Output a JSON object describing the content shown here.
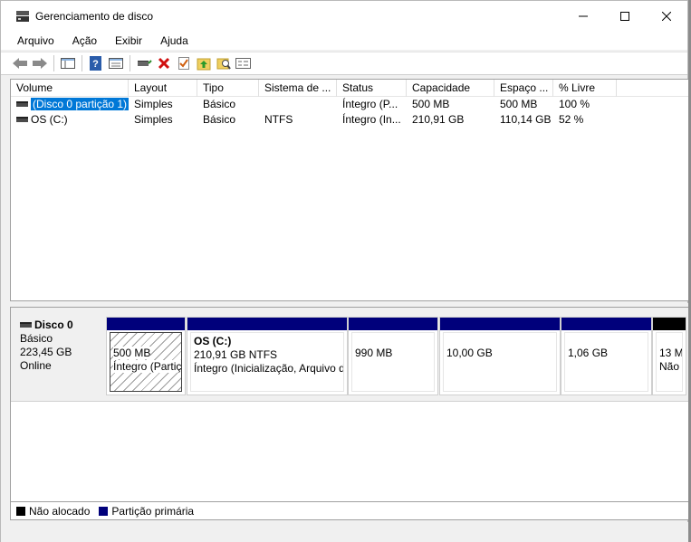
{
  "window": {
    "title": "Gerenciamento de disco"
  },
  "menu": [
    "Arquivo",
    "Ação",
    "Exibir",
    "Ajuda"
  ],
  "toolbar_icons": [
    "back-arrow-icon",
    "forward-arrow-icon",
    "console-tree-icon",
    "help-icon",
    "properties-view-icon",
    "connect-disk-icon",
    "delete-icon",
    "check-icon",
    "folder-up-icon",
    "folder-search-icon",
    "settings-list-icon"
  ],
  "columns": [
    "Volume",
    "Layout",
    "Tipo",
    "Sistema de ...",
    "Status",
    "Capacidade",
    "Espaço ...",
    "% Livre"
  ],
  "volumes": [
    {
      "volume": "(Disco 0 partição 1)",
      "layout": "Simples",
      "tipo": "Básico",
      "fs": "",
      "status": "Íntegro (P...",
      "capacidade": "500 MB",
      "espaco": "500 MB",
      "livre": "100 %",
      "selected": true
    },
    {
      "volume": "OS (C:)",
      "layout": "Simples",
      "tipo": "Básico",
      "fs": "NTFS",
      "status": "Íntegro (In...",
      "capacidade": "210,91 GB",
      "espaco": "110,14 GB",
      "livre": "52 %",
      "selected": false
    }
  ],
  "disk": {
    "name": "Disco 0",
    "type": "Básico",
    "size": "223,45 GB",
    "state": "Online",
    "partitions": [
      {
        "title": "",
        "line1": "500 MB",
        "line2": "Íntegro (Partiç",
        "bar": "primary",
        "selected": true
      },
      {
        "title": "OS  (C:)",
        "line1": "210,91 GB NTFS",
        "line2": "Íntegro (Inicialização, Arquivo d",
        "bar": "primary",
        "selected": false
      },
      {
        "title": "",
        "line1": "990 MB",
        "line2": "",
        "bar": "primary",
        "selected": false
      },
      {
        "title": "",
        "line1": "10,00 GB",
        "line2": "",
        "bar": "primary",
        "selected": false
      },
      {
        "title": "",
        "line1": "1,06 GB",
        "line2": "",
        "bar": "primary",
        "selected": false
      },
      {
        "title": "",
        "line1": "13 M",
        "line2": "Não",
        "bar": "unallocated",
        "selected": false
      }
    ]
  },
  "legend": [
    {
      "label": "Não alocado",
      "color": "#000000"
    },
    {
      "label": "Partição primária",
      "color": "#00007b"
    }
  ]
}
